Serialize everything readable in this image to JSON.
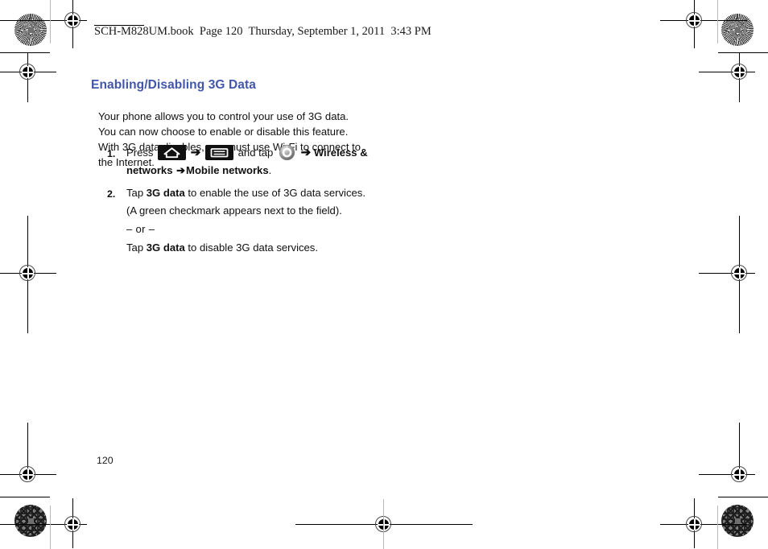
{
  "document": {
    "header_slug": "SCH-M828UM.book  Page 120  Thursday, September 1, 2011  3:43 PM",
    "page_number": "120",
    "accent_color": "#4256ab"
  },
  "section": {
    "title": "Enabling/Disabling 3G Data",
    "intro": "Your phone allows you to control your use of 3G data. You can now choose to enable or disable this feature. With 3G data disables, you must use Wi-Fi to connect to the Internet."
  },
  "steps": [
    {
      "number": "1.",
      "lead": "Press",
      "icon_home": "home-icon",
      "arrow1": "➔",
      "icon_menu": "menu-icon",
      "mid": "and tap",
      "icon_settings": "settings-icon",
      "arrow2": "➔",
      "bold1": "Wireless & networks",
      "arrow3": "➔",
      "bold2": "Mobile networks",
      "tail": "."
    },
    {
      "number": "2.",
      "line1_pre": "Tap ",
      "line1_bold": "3G data",
      "line1_post": " to enable the use of 3G data services. (A green checkmark appears next to the field).",
      "or": "– or –",
      "line2_pre": "Tap ",
      "line2_bold": "3G data",
      "line2_post": " to disable 3G data services."
    }
  ],
  "print_marks": {
    "rosette_label": "registration-rosette",
    "crosshair_label": "registration-crosshair",
    "crop_label": "crop-mark"
  }
}
